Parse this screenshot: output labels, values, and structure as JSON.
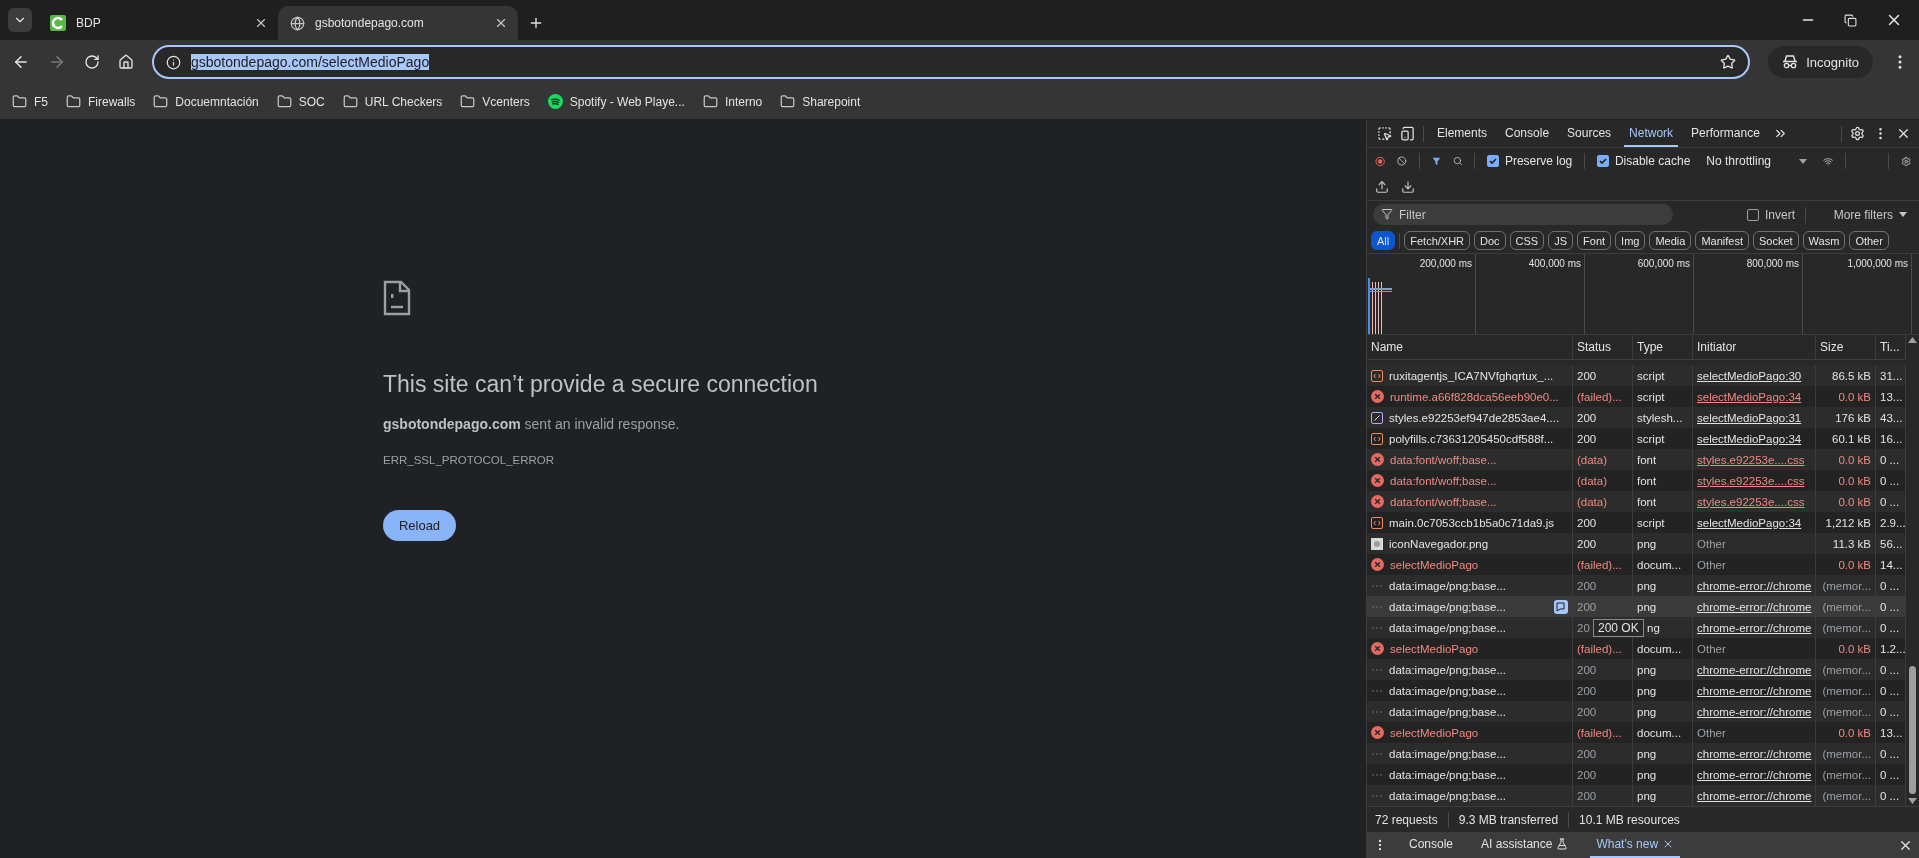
{
  "browser": {
    "tabs": [
      {
        "title": "BDP",
        "selected": false,
        "kind": "bdp"
      },
      {
        "title": "gsbotondepago.com",
        "selected": true,
        "kind": "globe"
      }
    ],
    "address": {
      "value": "gsbotondepago.com/selectMedioPago",
      "highlighted": true
    },
    "incognito": "Incognito",
    "bookmarks": [
      {
        "label": "F5",
        "kind": "folder"
      },
      {
        "label": "Firewalls",
        "kind": "folder"
      },
      {
        "label": "Docuemntación",
        "kind": "folder"
      },
      {
        "label": "SOC",
        "kind": "folder"
      },
      {
        "label": "URL Checkers",
        "kind": "folder"
      },
      {
        "label": "Vcenters",
        "kind": "folder"
      },
      {
        "label": "Spotify - Web Playe...",
        "kind": "spotify"
      },
      {
        "label": "Interno",
        "kind": "folder"
      },
      {
        "label": "Sharepoint",
        "kind": "folder"
      }
    ]
  },
  "error_page": {
    "title": "This site can’t provide a secure connection",
    "message": "**gsbotondepago.com** sent an invalid response.",
    "code": "ERR_SSL_PROTOCOL_ERROR",
    "button": "Reload"
  },
  "devtools": {
    "tabs": [
      {
        "label": "Elements",
        "selected": false
      },
      {
        "label": "Console",
        "selected": false
      },
      {
        "label": "Sources",
        "selected": false
      },
      {
        "label": "Network",
        "selected": true
      },
      {
        "label": "Performance",
        "selected": false
      }
    ],
    "preserve_log": {
      "label": "Preserve log",
      "checked": true
    },
    "disable_cache": {
      "label": "Disable cache",
      "checked": true
    },
    "throttling": "No throttling",
    "filter": {
      "placeholder": "Filter"
    },
    "invert": {
      "label": "Invert",
      "checked": false
    },
    "more_filters": "More filters",
    "type_filters": [
      {
        "label": "All",
        "selected": true
      },
      {
        "label": "Fetch/XHR",
        "selected": false
      },
      {
        "label": "Doc",
        "selected": false
      },
      {
        "label": "CSS",
        "selected": false
      },
      {
        "label": "JS",
        "selected": false
      },
      {
        "label": "Font",
        "selected": false
      },
      {
        "label": "Img",
        "selected": false
      },
      {
        "label": "Media",
        "selected": false
      },
      {
        "label": "Manifest",
        "selected": false
      },
      {
        "label": "Socket",
        "selected": false
      },
      {
        "label": "Wasm",
        "selected": false
      },
      {
        "label": "Other",
        "selected": false
      }
    ],
    "overview_ticks": [
      "200,000 ms",
      "400,000 ms",
      "600,000 ms",
      "800,000 ms",
      "1,000,000 ms"
    ],
    "columns": [
      "Name",
      "Status",
      "Type",
      "Initiator",
      "Size",
      "Ti..."
    ],
    "rows": [
      {
        "kind": "script",
        "name": "ruxitagentjs_ICA7NVfghqrtux_...",
        "status": "200",
        "type": "script",
        "initiator": "selectMedioPago:30",
        "initiator_link": true,
        "size": "86.5 kB",
        "time": "31...",
        "cached": false,
        "hovered": false
      },
      {
        "kind": "error",
        "name": "runtime.a66f828dca56eeb90e0...",
        "status": "(failed)...",
        "type": "script",
        "initiator": "selectMedioPago:34",
        "initiator_link": true,
        "size": "0.0 kB",
        "time": "13...",
        "cached": false,
        "hovered": false
      },
      {
        "kind": "stylesheet",
        "name": "styles.e92253ef947de2853ae4....",
        "status": "200",
        "type": "stylesh...",
        "initiator": "selectMedioPago:31",
        "initiator_link": true,
        "size": "176 kB",
        "time": "43...",
        "cached": false,
        "hovered": false
      },
      {
        "kind": "script",
        "name": "polyfills.c73631205450cdf588f...",
        "status": "200",
        "type": "script",
        "initiator": "selectMedioPago:34",
        "initiator_link": true,
        "size": "60.1 kB",
        "time": "16...",
        "cached": false,
        "hovered": false
      },
      {
        "kind": "error",
        "name": "data:font/woff;base...",
        "status": "(data)",
        "type": "font",
        "initiator": "styles.e92253e....css",
        "initiator_link": true,
        "size": "0.0 kB",
        "time": "0 ...",
        "cached": false,
        "hovered": false
      },
      {
        "kind": "error",
        "name": "data:font/woff;base...",
        "status": "(data)",
        "type": "font",
        "initiator": "styles.e92253e....css",
        "initiator_link": true,
        "size": "0.0 kB",
        "time": "0 ...",
        "cached": false,
        "hovered": false
      },
      {
        "kind": "error",
        "name": "data:font/woff;base...",
        "status": "(data)",
        "type": "font",
        "initiator": "styles.e92253e....css",
        "initiator_link": true,
        "size": "0.0 kB",
        "time": "0 ...",
        "cached": false,
        "hovered": false
      },
      {
        "kind": "script",
        "name": "main.0c7053ccb1b5a0c71da9.js",
        "status": "200",
        "type": "script",
        "initiator": "selectMedioPago:34",
        "initiator_link": true,
        "size": "1,212 kB",
        "time": "2.9...",
        "cached": false,
        "hovered": false
      },
      {
        "kind": "image",
        "name": "iconNavegador.png",
        "status": "200",
        "type": "png",
        "initiator": "Other",
        "initiator_link": false,
        "size": "11.3 kB",
        "time": "56...",
        "cached": false,
        "hovered": false
      },
      {
        "kind": "error",
        "name": "selectMedioPago",
        "status": "(failed)...",
        "type": "docum...",
        "initiator": "Other",
        "initiator_link": false,
        "size": "0.0 kB",
        "time": "14...",
        "cached": false,
        "hovered": false
      },
      {
        "kind": "data",
        "name": "data:image/png;base...",
        "status": "200",
        "type": "png",
        "initiator": "chrome-error://chrome",
        "initiator_link": true,
        "size": "(memor...",
        "time": "0 ...",
        "cached": true,
        "hovered": false
      },
      {
        "kind": "data",
        "name": "data:image/png;base...",
        "status": "200",
        "type": "png",
        "initiator": "chrome-error://chrome",
        "initiator_link": true,
        "size": "(memor...",
        "time": "0 ...",
        "cached": true,
        "hovered": true
      },
      {
        "kind": "data",
        "name": "data:image/png;base...",
        "status": "20",
        "type": "ng",
        "initiator": "chrome-error://chrome",
        "initiator_link": true,
        "size": "(memor...",
        "time": "0 ...",
        "cached": true,
        "hovered": false,
        "tooltip": "200 OK"
      },
      {
        "kind": "error",
        "name": "selectMedioPago",
        "status": "(failed)...",
        "type": "docum...",
        "initiator": "Other",
        "initiator_link": false,
        "size": "0.0 kB",
        "time": "1.2...",
        "cached": false,
        "hovered": false
      },
      {
        "kind": "data",
        "name": "data:image/png;base...",
        "status": "200",
        "type": "png",
        "initiator": "chrome-error://chrome",
        "initiator_link": true,
        "size": "(memor...",
        "time": "0 ...",
        "cached": true,
        "hovered": false
      },
      {
        "kind": "data",
        "name": "data:image/png;base...",
        "status": "200",
        "type": "png",
        "initiator": "chrome-error://chrome",
        "initiator_link": true,
        "size": "(memor...",
        "time": "0 ...",
        "cached": true,
        "hovered": false
      },
      {
        "kind": "data",
        "name": "data:image/png;base...",
        "status": "200",
        "type": "png",
        "initiator": "chrome-error://chrome",
        "initiator_link": true,
        "size": "(memor...",
        "time": "0 ...",
        "cached": true,
        "hovered": false
      },
      {
        "kind": "error",
        "name": "selectMedioPago",
        "status": "(failed)...",
        "type": "docum...",
        "initiator": "Other",
        "initiator_link": false,
        "size": "0.0 kB",
        "time": "13...",
        "cached": false,
        "hovered": false
      },
      {
        "kind": "data",
        "name": "data:image/png;base...",
        "status": "200",
        "type": "png",
        "initiator": "chrome-error://chrome",
        "initiator_link": true,
        "size": "(memor...",
        "time": "0 ...",
        "cached": true,
        "hovered": false
      },
      {
        "kind": "data",
        "name": "data:image/png;base...",
        "status": "200",
        "type": "png",
        "initiator": "chrome-error://chrome",
        "initiator_link": true,
        "size": "(memor...",
        "time": "0 ...",
        "cached": true,
        "hovered": false
      },
      {
        "kind": "data",
        "name": "data:image/png;base...",
        "status": "200",
        "type": "png",
        "initiator": "chrome-error://chrome",
        "initiator_link": true,
        "size": "(memor...",
        "time": "0 ...",
        "cached": true,
        "hovered": false
      }
    ],
    "summary": [
      "72 requests",
      "9.3 MB transferred",
      "10.1 MB resources"
    ],
    "drawer_tabs": [
      {
        "label": "Console",
        "selected": false,
        "kind": "plain"
      },
      {
        "label": "AI assistance",
        "selected": false,
        "kind": "experimental"
      },
      {
        "label": "What's new",
        "selected": true,
        "kind": "closable"
      }
    ]
  }
}
